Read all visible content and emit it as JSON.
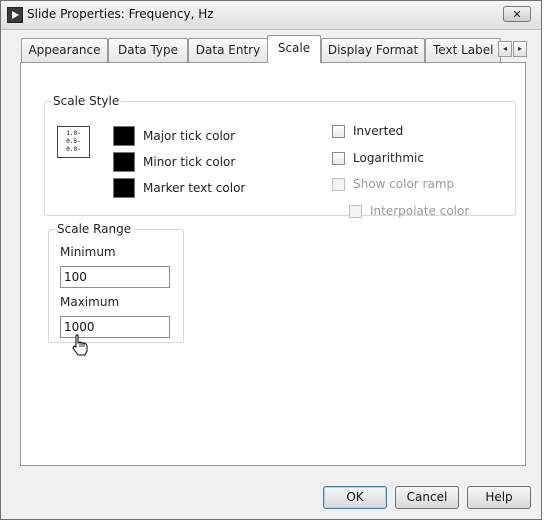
{
  "window": {
    "title": "Slide Properties: Frequency, Hz",
    "close_label": "✕"
  },
  "tabs": [
    {
      "label": "Appearance",
      "active": false
    },
    {
      "label": "Data Type",
      "active": false
    },
    {
      "label": "Data Entry",
      "active": false
    },
    {
      "label": "Scale",
      "active": true
    },
    {
      "label": "Display Format",
      "active": false
    },
    {
      "label": "Text Label",
      "active": false
    }
  ],
  "tab_scroll": {
    "left": "◂",
    "right": "▸"
  },
  "scale_style": {
    "legend": "Scale Style",
    "icon_ticks": [
      "1.0-",
      "0.5-",
      "0.0-"
    ],
    "colors": [
      {
        "label": "Major tick color",
        "color": "#000000"
      },
      {
        "label": "Minor tick color",
        "color": "#000000"
      },
      {
        "label": "Marker text color",
        "color": "#000000"
      }
    ],
    "options": [
      {
        "label": "Inverted",
        "checked": false,
        "disabled": false
      },
      {
        "label": "Logarithmic",
        "checked": false,
        "disabled": false
      },
      {
        "label": "Show color ramp",
        "checked": false,
        "disabled": true
      },
      {
        "label": "Interpolate color",
        "checked": false,
        "disabled": true
      }
    ]
  },
  "scale_range": {
    "legend": "Scale Range",
    "minimum_label": "Minimum",
    "minimum_value": "100",
    "maximum_label": "Maximum",
    "maximum_value": "1000"
  },
  "buttons": {
    "ok": "OK",
    "cancel": "Cancel",
    "help": "Help"
  }
}
